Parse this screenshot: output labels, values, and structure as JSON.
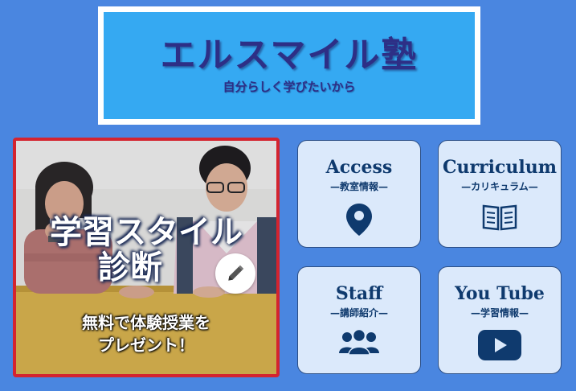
{
  "header": {
    "title": "エルスマイル塾",
    "subtitle": "自分らしく学びたいから"
  },
  "feature": {
    "title_line1": "学習スタイル",
    "title_line2": "診断",
    "sub_line1": "無料で体験授業を",
    "sub_line2": "プレゼント！",
    "action_icon": "pencil-icon"
  },
  "nav": [
    {
      "title": "Access",
      "subtitle": "—教室情報—",
      "icon": "map-pin-icon"
    },
    {
      "title": "Curriculum",
      "subtitle": "—カリキュラム—",
      "icon": "book-icon"
    },
    {
      "title": "Staff",
      "subtitle": "—講師紹介—",
      "icon": "users-icon"
    },
    {
      "title": "You Tube",
      "subtitle": "—学習情報—",
      "icon": "youtube-play-icon"
    }
  ],
  "colors": {
    "background": "#4a86e0",
    "logo_panel": "#35a9f2",
    "logo_text": "#2d2f86",
    "card_background": "#dbe9fb",
    "card_text": "#0f3a6e",
    "feature_border": "#d4242f"
  }
}
